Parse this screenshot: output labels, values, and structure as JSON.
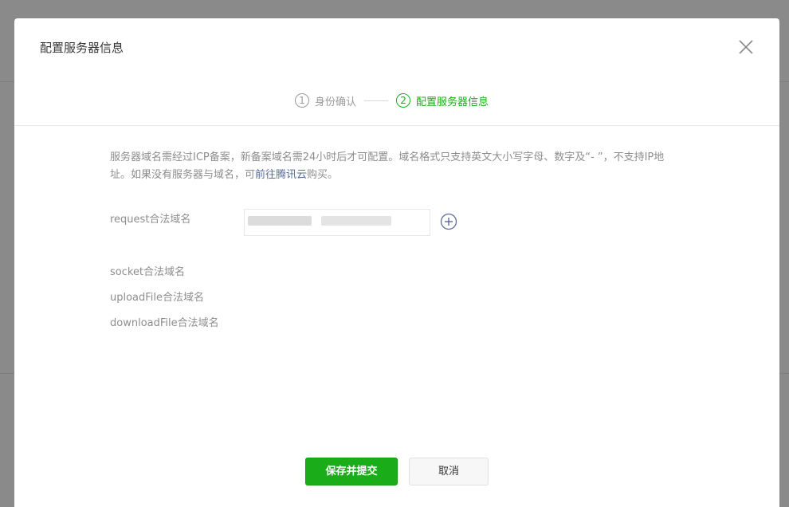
{
  "dialog": {
    "title": "配置服务器信息",
    "close_icon": "close-icon"
  },
  "steps": [
    {
      "num": "1",
      "label": "身份确认",
      "active": false
    },
    {
      "num": "2",
      "label": "配置服务器信息",
      "active": true
    }
  ],
  "notice": {
    "text": "服务器域名需经过ICP备案，新备案域名需24小时后才可配置。域名格式只支持英文大小写字母、数字及“- ”，不支持IP地址。如果没有服务器与域名，可",
    "link_text": "前往腾讯云",
    "suffix": "购买。"
  },
  "fields": {
    "request_label": "request合法域名",
    "socket_label": "socket合法域名",
    "upload_label": "uploadFile合法域名",
    "download_label": "downloadFile合法域名",
    "add_icon": "plus-circle-icon"
  },
  "buttons": {
    "save": "保存并提交",
    "cancel": "取消"
  },
  "colors": {
    "accent": "#1aad19",
    "link": "#576b95",
    "text_muted": "#8d8d8d"
  }
}
